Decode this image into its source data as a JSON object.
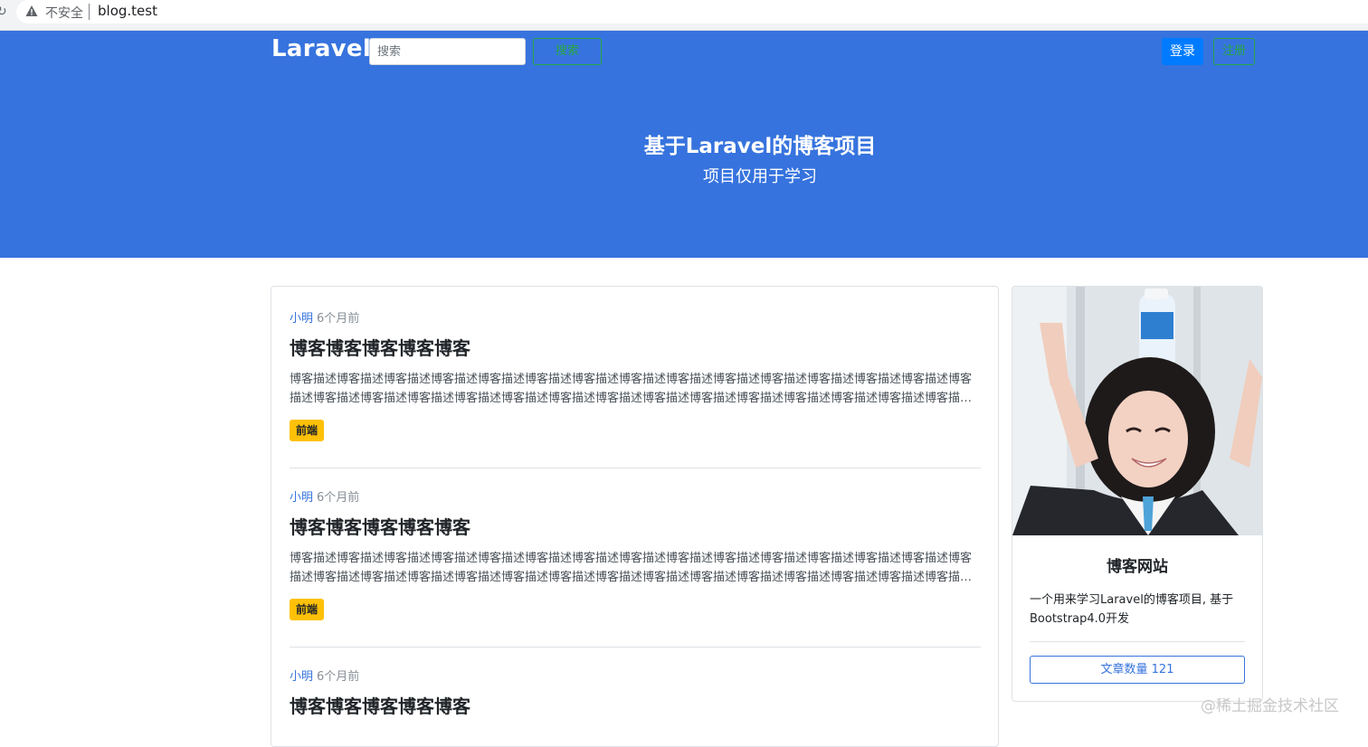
{
  "browser": {
    "security_label": "不安全",
    "url": "blog.test"
  },
  "navbar": {
    "brand": "Laravel",
    "search_placeholder": "搜索",
    "search_button": "搜索",
    "login": "登录",
    "register": "注册"
  },
  "hero": {
    "title": "基于Laravel的博客项目",
    "subtitle": "项目仅用于学习"
  },
  "articles": [
    {
      "author": "小明",
      "time": "6个月前",
      "title": "博客博客博客博客博客",
      "description": "博客描述博客描述博客描述博客描述博客描述博客描述博客描述博客描述博客描述博客描述博客描述博客描述博客描述博客描述博客描述博客描述博客描述博客描述博客描述博客描述博客描述博客描述博客描述博客描述博客描述博客描述博客描述博客描述博客描述博客描述博客描述博客描述博客描述博客描述博客描述",
      "tag": "前端"
    },
    {
      "author": "小明",
      "time": "6个月前",
      "title": "博客博客博客博客博客",
      "description": "博客描述博客描述博客描述博客描述博客描述博客描述博客描述博客描述博客描述博客描述博客描述博客描述博客描述博客描述博客描述博客描述博客描述博客描述博客描述博客描述博客描述博客描述博客描述博客描述博客描述博客描述博客描述博客描述博客描述博客描述博客描述博客描述博客描述博客描述博客描述",
      "tag": "前端"
    },
    {
      "author": "小明",
      "time": "6个月前",
      "title": "博客博客博客博客博客"
    }
  ],
  "sidebar": {
    "title": "博客网站",
    "description": "一个用来学习Laravel的博客项目, 基于Bootstrap4.0开发",
    "count_button": "文章数量 121"
  },
  "watermark": "@稀土掘金技术社区",
  "colors": {
    "primary": "#3673de",
    "success": "#28a745",
    "login": "#007bff",
    "tag": "#ffc107"
  }
}
